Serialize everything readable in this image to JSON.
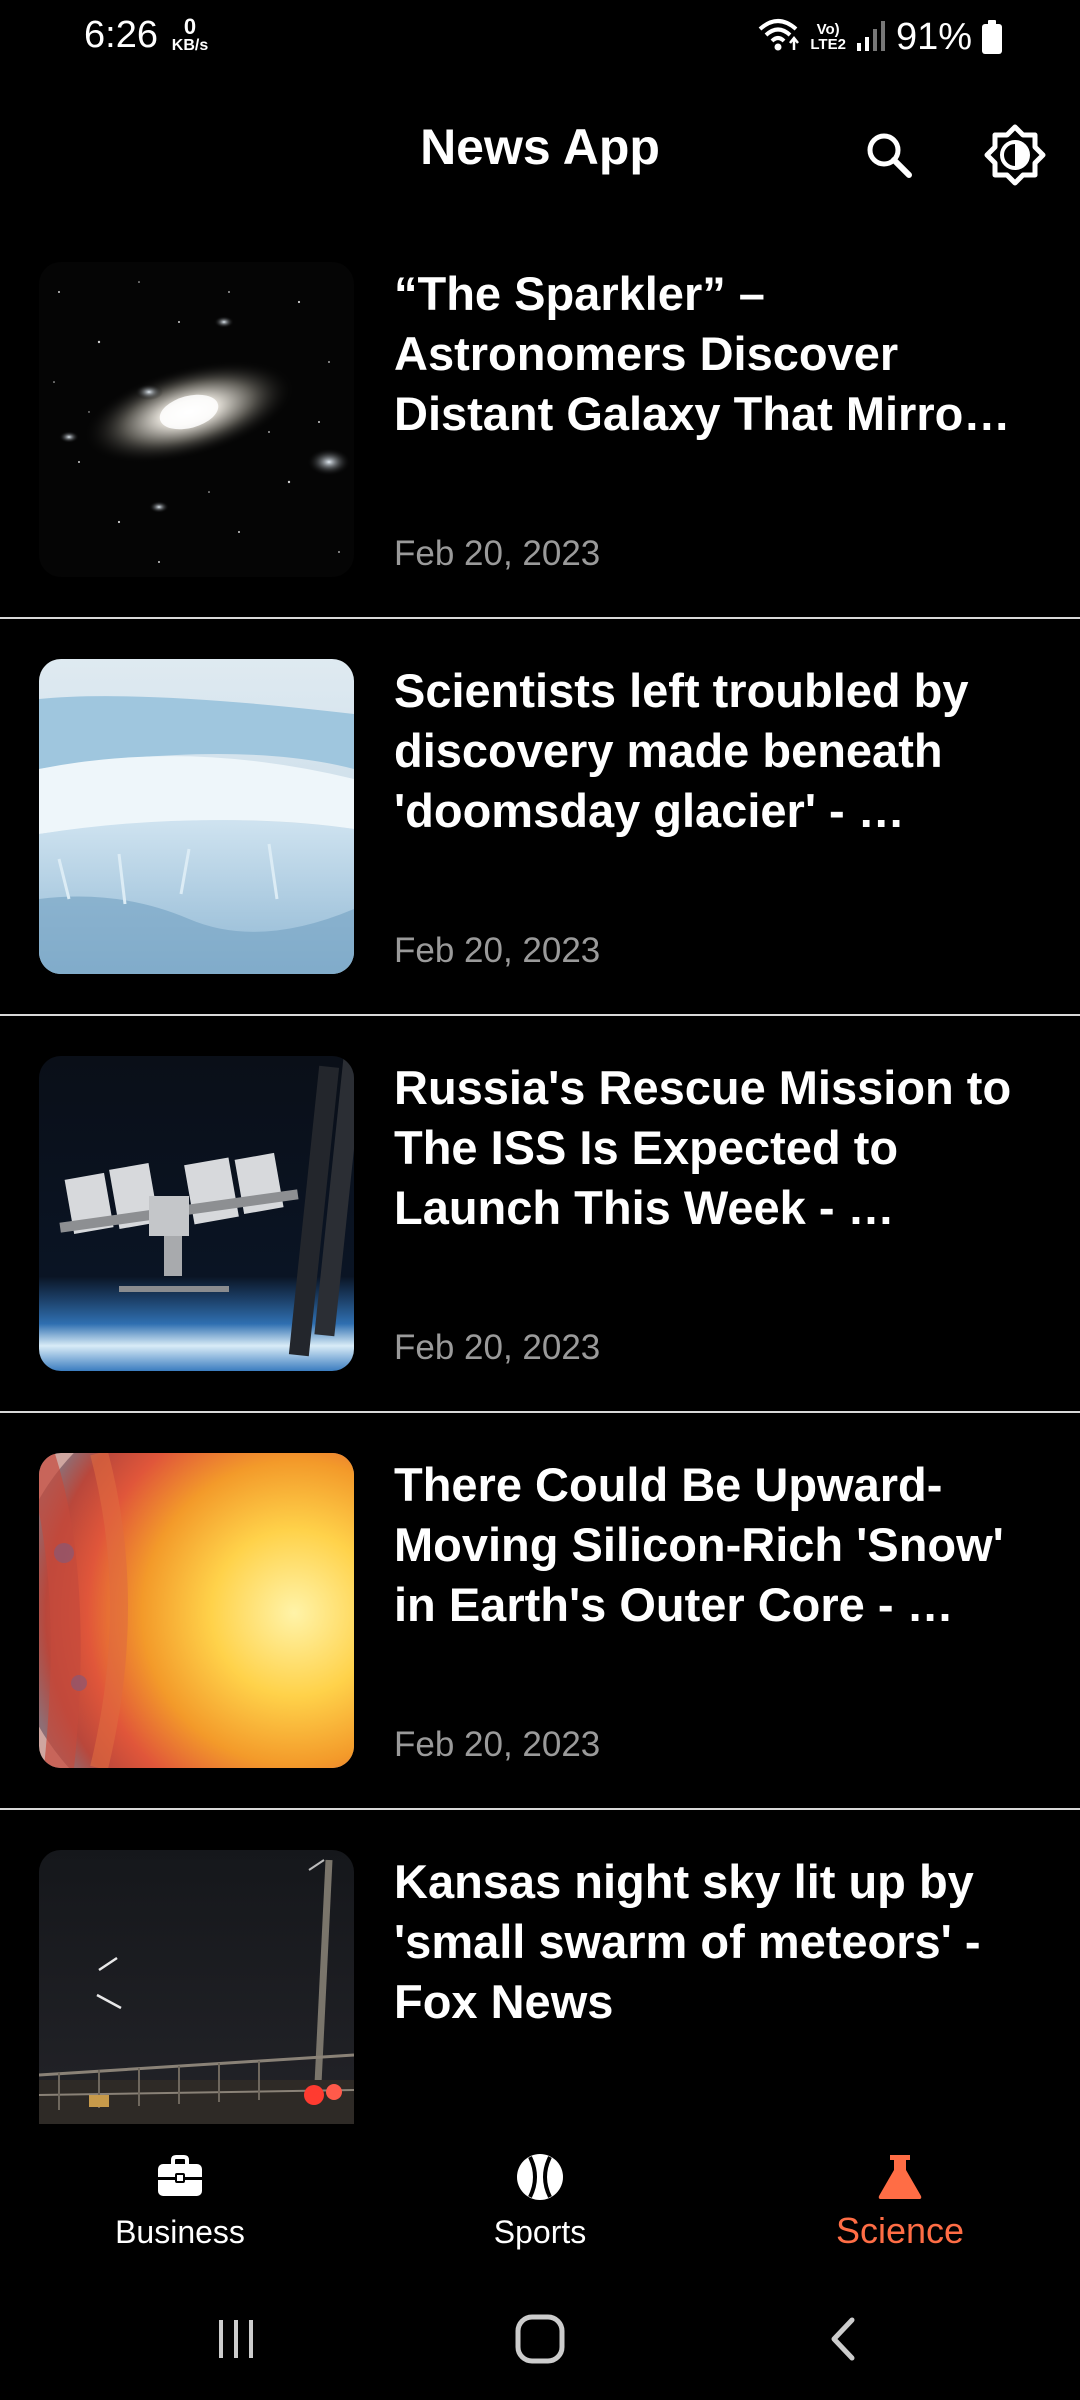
{
  "status_bar": {
    "time": "6:26",
    "net_speed_value": "0",
    "net_speed_unit": "KB/s",
    "volte_top": "Vo)",
    "volte_bottom": "LTE2",
    "battery_percent": "91%"
  },
  "header": {
    "title": "News App",
    "search_icon": "search-icon",
    "theme_icon": "brightness-icon"
  },
  "articles": [
    {
      "title": "“The Sparkler” – Astronomers Discover Distant Galaxy That Mirro…",
      "date": "Feb 20, 2023",
      "image": "galaxy-image"
    },
    {
      "title": "Scientists left troubled by discovery made beneath 'doomsday glacier' - …",
      "date": "Feb 20, 2023",
      "image": "glacier-image"
    },
    {
      "title": "Russia's Rescue Mission to The ISS Is Expected to Launch This Week - …",
      "date": "Feb 20, 2023",
      "image": "iss-image"
    },
    {
      "title": "There Could Be Upward-Moving Silicon-Rich 'Snow' in Earth's Outer Core - …",
      "date": "Feb 20, 2023",
      "image": "earth-core-image"
    },
    {
      "title": "Kansas night sky lit up by 'small swarm of meteors' - Fox News",
      "date": "",
      "image": "meteor-image"
    }
  ],
  "bottom_nav": {
    "items": [
      {
        "label": "Business",
        "icon": "briefcase-icon"
      },
      {
        "label": "Sports",
        "icon": "baseball-icon"
      },
      {
        "label": "Science",
        "icon": "flask-icon",
        "active": true
      }
    ],
    "active_color": "#ff6d45"
  },
  "system_nav": {
    "recents": "recents-icon",
    "home": "home-icon",
    "back": "back-icon"
  }
}
